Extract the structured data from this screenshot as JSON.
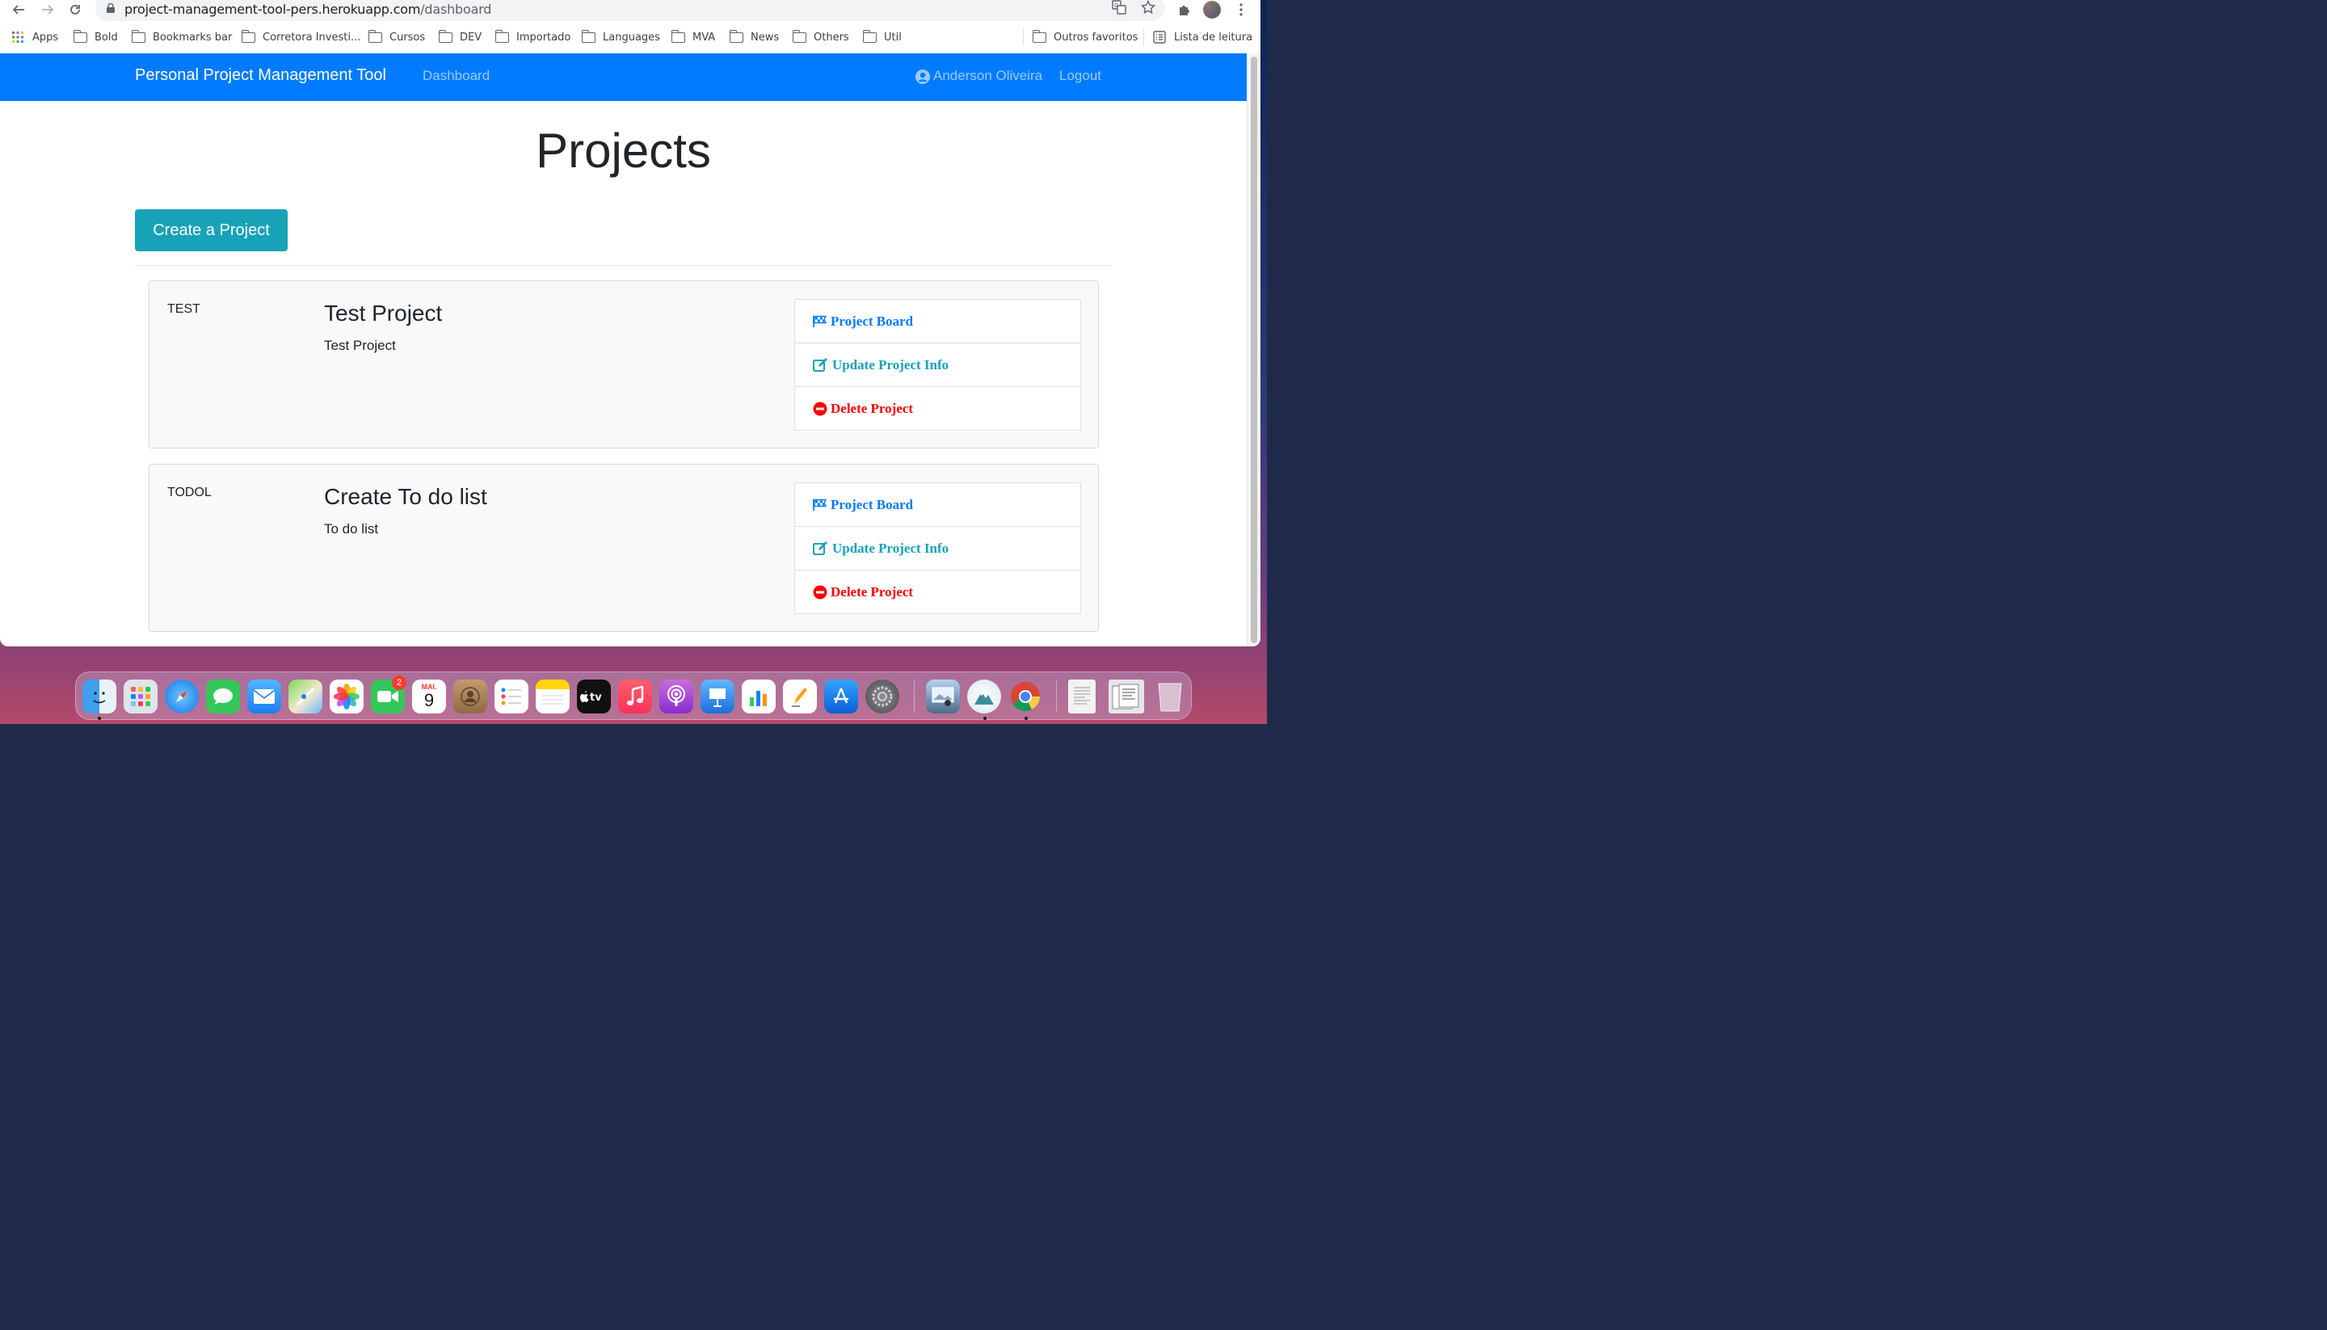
{
  "browser": {
    "url_host": "project-management-tool-pers.herokuapp.com",
    "url_path": "/dashboard",
    "bookmarks": [
      "Apps",
      "Bold",
      "Bookmarks bar",
      "Corretora Investi...",
      "Cursos",
      "DEV",
      "Importado",
      "Languages",
      "MVA",
      "News",
      "Others",
      "Util"
    ],
    "other_bookmarks": "Outros favoritos",
    "reading_list": "Lista de leitura"
  },
  "navbar": {
    "brand": "Personal Project Management Tool",
    "dashboard": "Dashboard",
    "user": "Anderson Oliveira",
    "logout": "Logout",
    "color": "#007bff"
  },
  "main": {
    "title": "Projects",
    "create_button": "Create a Project",
    "projects": [
      {
        "identifier": "TEST",
        "name": "Test Project",
        "description": "Test Project",
        "actions": {
          "board": "Project Board",
          "update": "Update Project Info",
          "delete": "Delete Project"
        }
      },
      {
        "identifier": "TODOL",
        "name": "Create To do list",
        "description": "To do list",
        "actions": {
          "board": "Project Board",
          "update": "Update Project Info",
          "delete": "Delete Project"
        }
      }
    ]
  },
  "dock": {
    "calendar_month": "MAI.",
    "calendar_day": "9",
    "facetime_badge": "2",
    "apps": [
      "finder-icon",
      "launchpad-icon",
      "safari-icon",
      "messages-icon",
      "mail-icon",
      "maps-icon",
      "photos-icon",
      "facetime-icon",
      "calendar-icon",
      "contacts-icon",
      "reminders-icon",
      "notes-icon",
      "apple-tv-icon",
      "music-icon",
      "podcasts-icon",
      "keynote-icon",
      "numbers-icon",
      "pages-icon",
      "app-store-icon",
      "system-preferences-icon",
      "preview-icon",
      "sourcetree-icon",
      "chrome-icon",
      "pdf-document-icon",
      "document-stack-icon",
      "trash-icon"
    ]
  }
}
